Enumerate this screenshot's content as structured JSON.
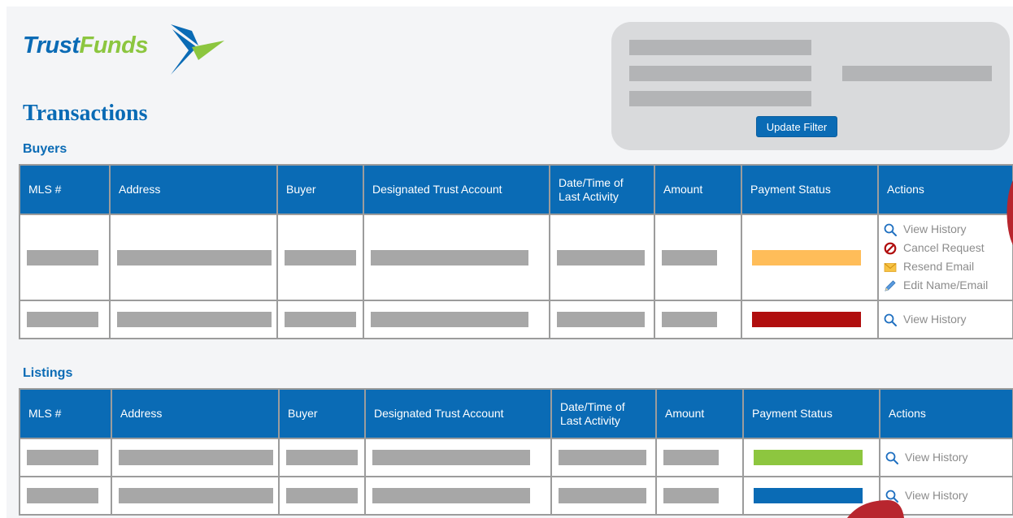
{
  "brand": {
    "name_part1": "Trust",
    "name_part2": "Funds"
  },
  "page_title": "Transactions",
  "filter": {
    "button_label": "Update Filter"
  },
  "columns": [
    "MLS #",
    "Address",
    "Buyer",
    "Designated Trust Account",
    "Date/Time of Last Activity",
    "Amount",
    "Payment Status",
    "Actions"
  ],
  "buyers": {
    "title": "Buyers",
    "rows": [
      {
        "status_color": "#ffbd59",
        "actions": [
          "View History",
          "Cancel Request",
          "Resend Email",
          "Edit Name/Email"
        ]
      },
      {
        "status_color": "#b00e0e",
        "actions": [
          "View History"
        ]
      }
    ]
  },
  "listings": {
    "title": "Listings",
    "rows": [
      {
        "status_color": "#8dc63f",
        "actions": [
          "View History"
        ]
      },
      {
        "status_color": "#0a6bb5",
        "actions": [
          "View History"
        ]
      }
    ]
  },
  "icons": {
    "View History": "search-icon",
    "Cancel Request": "cancel-icon",
    "Resend Email": "envelope-icon",
    "Edit Name/Email": "pencil-icon"
  },
  "colors": {
    "primary": "#0a6bb5",
    "brand_green": "#8cc63f"
  }
}
